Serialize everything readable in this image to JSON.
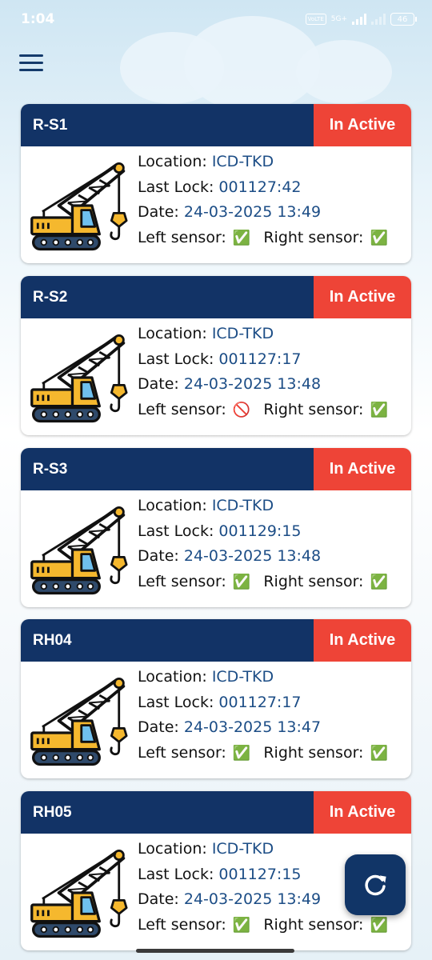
{
  "status_bar": {
    "time": "1:04",
    "net_badge": "VoLTE",
    "net_label": "5G+",
    "battery": "46"
  },
  "cranes": [
    {
      "name": "R-S1",
      "status": "In Active",
      "location_label": "Location:",
      "location": "ICD-TKD",
      "lock_label": "Last Lock:",
      "last_lock": "001127:42",
      "date_label": "Date:",
      "date": "24-03-2025 13:49",
      "left_label": "Left sensor:",
      "left_sensor": "✅",
      "right_label": "Right sensor:",
      "right_sensor": "✅"
    },
    {
      "name": "R-S2",
      "status": "In Active",
      "location_label": "Location:",
      "location": "ICD-TKD",
      "lock_label": "Last Lock:",
      "last_lock": "001127:17",
      "date_label": "Date:",
      "date": "24-03-2025 13:48",
      "left_label": "Left sensor:",
      "left_sensor": "🚫",
      "right_label": "Right sensor:",
      "right_sensor": "✅"
    },
    {
      "name": "R-S3",
      "status": "In Active",
      "location_label": "Location:",
      "location": "ICD-TKD",
      "lock_label": "Last Lock:",
      "last_lock": "001129:15",
      "date_label": "Date:",
      "date": "24-03-2025 13:48",
      "left_label": "Left sensor:",
      "left_sensor": "✅",
      "right_label": "Right sensor:",
      "right_sensor": "✅"
    },
    {
      "name": "RH04",
      "status": "In Active",
      "location_label": "Location:",
      "location": "ICD-TKD",
      "lock_label": "Last Lock:",
      "last_lock": "001127:17",
      "date_label": "Date:",
      "date": "24-03-2025 13:47",
      "left_label": "Left sensor:",
      "left_sensor": "✅",
      "right_label": "Right sensor:",
      "right_sensor": "✅"
    },
    {
      "name": "RH05",
      "status": "In Active",
      "location_label": "Location:",
      "location": "ICD-TKD",
      "lock_label": "Last Lock:",
      "last_lock": "001127:15",
      "date_label": "Date:",
      "date": "24-03-2025 13:49",
      "left_label": "Left sensor:",
      "left_sensor": "✅",
      "right_label": "Right sensor:",
      "right_sensor": "✅"
    }
  ],
  "icons": {
    "menu": "hamburger-menu-icon",
    "crane": "crane-icon",
    "refresh": "refresh-icon"
  },
  "colors": {
    "header_navy": "#123366",
    "status_red": "#ee4437",
    "value_blue": "#1c4d86",
    "ok_green": "#2bb34b"
  }
}
